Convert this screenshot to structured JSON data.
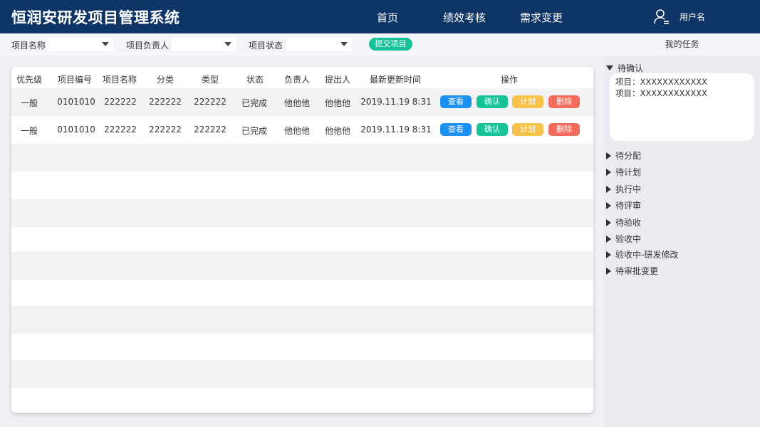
{
  "header": {
    "title": "恒润安研发项目管理系统",
    "nav": [
      "首页",
      "绩效考核",
      "需求变更"
    ],
    "username": "用户名"
  },
  "filters": {
    "project_name_label": "项目名称",
    "project_name_value": "",
    "owner_label": "项目负责人",
    "owner_value": "",
    "status_label": "项目状态",
    "status_value": "",
    "submit_label": "提交项目"
  },
  "table": {
    "columns": [
      "优先级",
      "项目编号",
      "项目名称",
      "分类",
      "类型",
      "状态",
      "负责人",
      "提出人",
      "最新更新时间",
      "操作"
    ],
    "rows": [
      {
        "priority": "一般",
        "code": "0101010",
        "name": "222222",
        "category": "222222",
        "type": "222222",
        "status": "已完成",
        "owner": "他他他",
        "proposer": "他他他",
        "updated": "2019.11.19 8:31"
      },
      {
        "priority": "一般",
        "code": "0101010",
        "name": "222222",
        "category": "222222",
        "type": "222222",
        "status": "已完成",
        "owner": "他他他",
        "proposer": "他他他",
        "updated": "2019.11.19 8:31"
      }
    ],
    "actions": {
      "view": "查看",
      "confirm": "确认",
      "plan": "计划",
      "delete": "删除"
    }
  },
  "panel": {
    "title": "我的任务",
    "expanded": {
      "label": "待确认",
      "items": [
        "项目：XXXXXXXXXXXX",
        "项目：XXXXXXXXXXXX"
      ]
    },
    "collapsed": [
      "待分配",
      "待计划",
      "执行中",
      "待评审",
      "待验收",
      "验收中",
      "验收中-研发修改",
      "待审批变更"
    ]
  },
  "colors": {
    "header_bg": "#0f3466",
    "view": "#1e90f0",
    "confirm": "#19c39a",
    "plan": "#f7c24b",
    "delete": "#f26b5b",
    "submit": "#17c29a"
  },
  "icons": {
    "user": "user-icon",
    "dropdown": "caret-down-icon",
    "collapsed": "caret-right-icon",
    "expanded": "caret-down-icon"
  }
}
